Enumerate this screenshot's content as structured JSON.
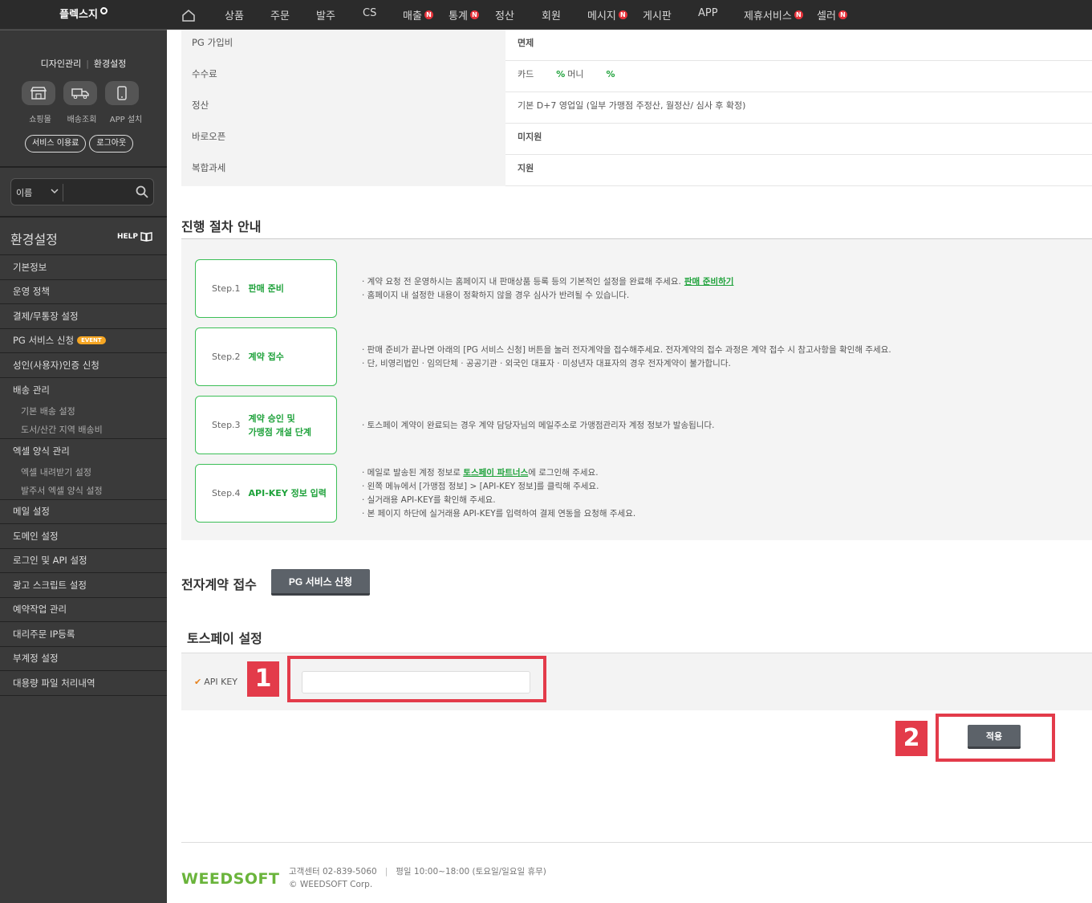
{
  "brand": "플렉스지",
  "nav": {
    "items": [
      {
        "label": "상품",
        "badge": ""
      },
      {
        "label": "주문",
        "badge": ""
      },
      {
        "label": "발주",
        "badge": ""
      },
      {
        "label": "CS",
        "badge": ""
      },
      {
        "label": "매출",
        "badge": "N"
      },
      {
        "label": "통계",
        "badge": "N"
      },
      {
        "label": "정산",
        "badge": ""
      },
      {
        "label": "회원",
        "badge": ""
      },
      {
        "label": "메시지",
        "badge": "N"
      },
      {
        "label": "게시판",
        "badge": ""
      },
      {
        "label": "APP",
        "badge": ""
      },
      {
        "label": "제휴서비스",
        "badge": "N"
      },
      {
        "label": "셀러",
        "badge": "N"
      }
    ]
  },
  "sidebar": {
    "link1": "디자인관리",
    "link2": "환경설정",
    "icons": [
      {
        "icon": "store-icon",
        "label": "쇼핑몰"
      },
      {
        "icon": "truck-icon",
        "label": "배송조회"
      },
      {
        "icon": "phone-icon",
        "label": "APP 설치"
      }
    ],
    "btn_fee": "서비스 이용료",
    "btn_logout": "로그아웃",
    "search_select": "이름",
    "search_placeholder": "",
    "title": "환경설정",
    "help": "HELP",
    "menu": [
      {
        "label": "기본정보",
        "type": "item"
      },
      {
        "label": "운영 정책",
        "type": "item"
      },
      {
        "label": "결제/무통장 설정",
        "type": "item"
      },
      {
        "label": "PG 서비스 신청",
        "type": "item",
        "badge": "EVENT"
      },
      {
        "label": "성인(사용자)인증 신청",
        "type": "item"
      },
      {
        "label": "배송 관리",
        "type": "group"
      },
      {
        "label": "기본 배송 설정",
        "type": "sub"
      },
      {
        "label": "도서/산간 지역 배송비",
        "type": "sub"
      },
      {
        "label": "엑셀 양식 관리",
        "type": "group"
      },
      {
        "label": "엑셀 내려받기 설정",
        "type": "sub"
      },
      {
        "label": "발주서 엑셀 양식 설정",
        "type": "sub"
      },
      {
        "label": "메일 설정",
        "type": "item"
      },
      {
        "label": "도메인 설정",
        "type": "item"
      },
      {
        "label": "로그인 및 API 설정",
        "type": "item"
      },
      {
        "label": "광고 스크립트 설정",
        "type": "item"
      },
      {
        "label": "예약작업 관리",
        "type": "item"
      },
      {
        "label": "대리주문 IP등록",
        "type": "item"
      },
      {
        "label": "부계정 설정",
        "type": "item"
      },
      {
        "label": "대용량 파일 처리내역",
        "type": "item"
      }
    ]
  },
  "info_rows": [
    {
      "label": "PG 가입비",
      "value": "면제"
    },
    {
      "label": "수수료",
      "value_parts": [
        "카드",
        "%",
        "머니",
        "%"
      ]
    },
    {
      "label": "정산",
      "value": "기본 D+7 영업일 (일부 가맹점 주정산, 월정산/ 심사 후 확정)"
    },
    {
      "label": "바로오픈",
      "value": "미지원"
    },
    {
      "label": "복합과세",
      "value": "지원"
    }
  ],
  "process": {
    "title": "진행 절차 안내",
    "steps": [
      {
        "num": "Step.1",
        "title": "판매 준비",
        "desc": [
          "· 계약 요청 전 운영하시는 홈페이지 내 판매상품 등록 등의 기본적인 설정을 완료해 주세요.",
          "· 홈페이지 내 설정한 내용이 정확하지 않을 경우 심사가 반려될 수 있습니다."
        ],
        "link": "판매 준비하기"
      },
      {
        "num": "Step.2",
        "title": "계약 접수",
        "desc": [
          "· 판매 준비가 끝나면 아래의 [PG 서비스 신청] 버튼을 눌러 전자계약을 접수해주세요. 전자계약의 접수 과정은 계약 접수 시 참고사항을 확인해 주세요.",
          "· 단, 비영리법인 · 임의단체 · 공공기관 · 외국인 대표자 · 미성년자 대표자의 경우 전자계약이 불가합니다."
        ]
      },
      {
        "num": "Step.3",
        "title": "계약 승인 및",
        "title2": "가맹점 개설 단계",
        "desc": [
          "· 토스페이 계약이 완료되는 경우 계약 담당자님의 메일주소로 가맹점관리자 계정 정보가 발송됩니다."
        ]
      },
      {
        "num": "Step.4",
        "title": "API-KEY 정보 입력",
        "desc_pre": "· 메일로 발송된 계정 정보로 ",
        "desc_link": "토스페이 파트너스",
        "desc_post": "에 로그인해 주세요.",
        "desc": [
          "· 왼쪽 메뉴에서 [가맹점 정보] > [API-KEY 정보]를 클릭해 주세요.",
          "· 실거래용 API-KEY를 확인해 주세요.",
          "· 본 페이지 하단에 실거래용 API-KEY를 입력하여 결제 연동을 요청해 주세요."
        ]
      }
    ]
  },
  "contract": {
    "title": "전자계약 접수",
    "button": "PG 서비스 신청"
  },
  "tosspay": {
    "title": "토스페이 설정",
    "api_label": "API KEY",
    "api_value": "",
    "apply": "적용"
  },
  "annotations": {
    "n1": "1",
    "n2": "2",
    "color": "#e33b4a"
  },
  "footer": {
    "logo": "WEEDSOFT",
    "contact": "고객센터 02-839-5060",
    "hours": "평일 10:00~18:00 (토요일/일요일 휴무)",
    "copyright": "© WEEDSOFT Corp."
  }
}
